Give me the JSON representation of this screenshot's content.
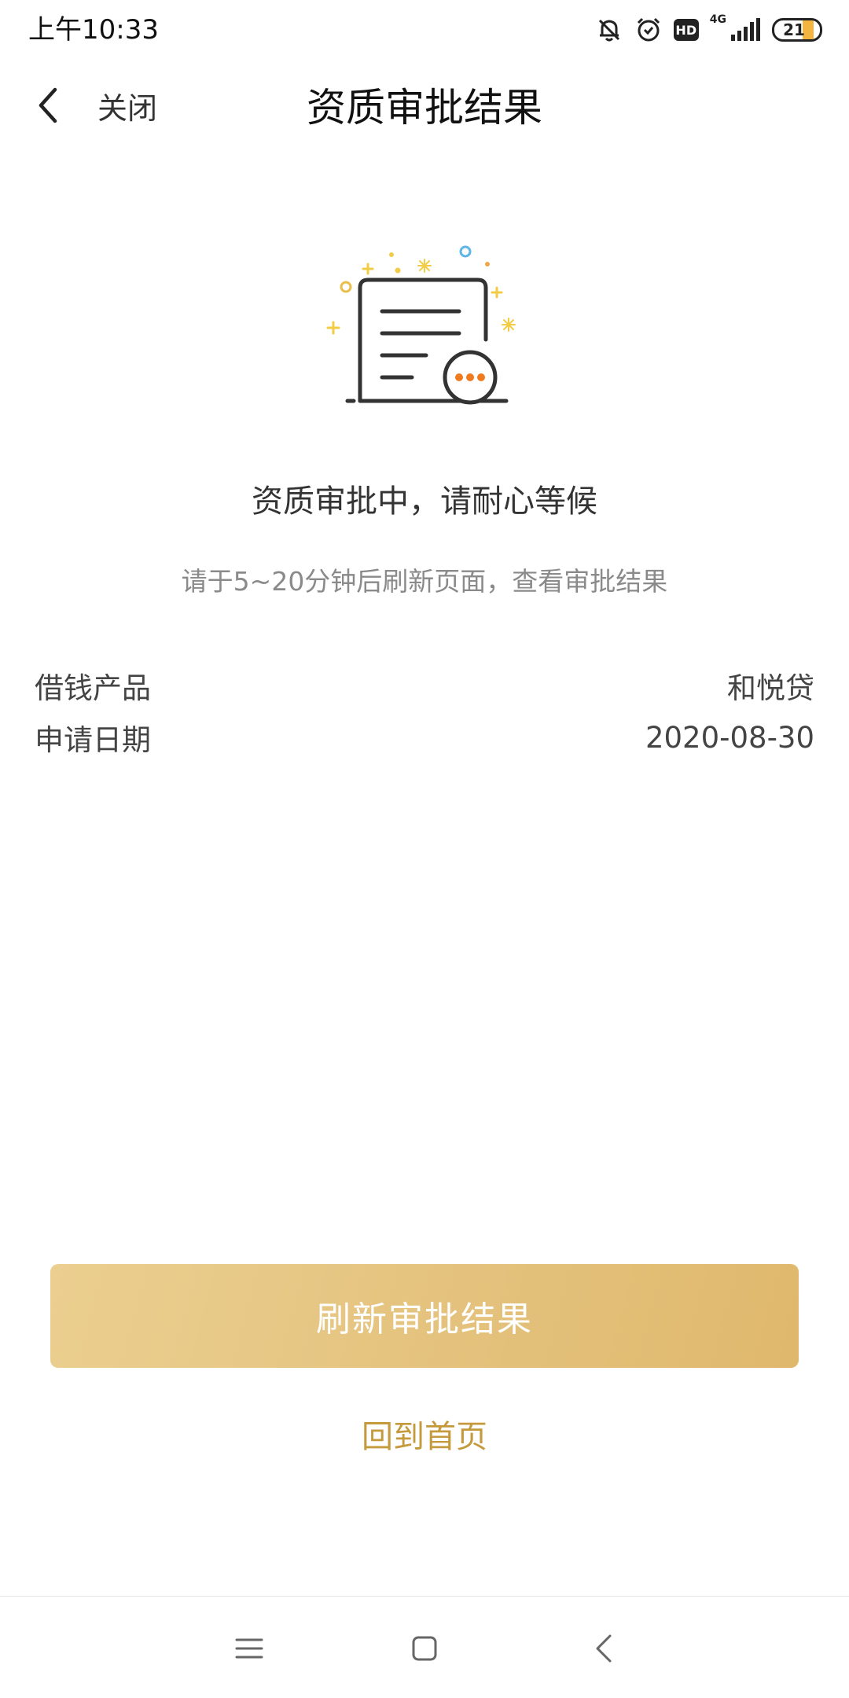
{
  "status_bar": {
    "time": "上午10:33",
    "hd_label": "HD",
    "network": "4G",
    "battery": "21",
    "battery_level": 0.21
  },
  "nav": {
    "close_label": "关闭",
    "title": "资质审批结果"
  },
  "message": {
    "main": "资质审批中，请耐心等候",
    "sub": "请于5~20分钟后刷新页面，查看审批结果"
  },
  "info": [
    {
      "label": "借钱产品",
      "value": "和悦贷"
    },
    {
      "label": "申请日期",
      "value": "2020-08-30"
    }
  ],
  "actions": {
    "refresh_label": "刷新审批结果",
    "home_label": "回到首页"
  },
  "colors": {
    "accent_gold": "#c49a3c",
    "button_gold": "#e4c27d",
    "illustration_orange": "#f07b1f"
  },
  "icons": {
    "status": [
      "mute-bell-icon",
      "alarm-icon",
      "hd-icon",
      "signal-icon",
      "battery-icon"
    ],
    "nav": [
      "back-arrow-icon"
    ],
    "system": [
      "menu-icon",
      "home-icon",
      "back-icon"
    ]
  }
}
